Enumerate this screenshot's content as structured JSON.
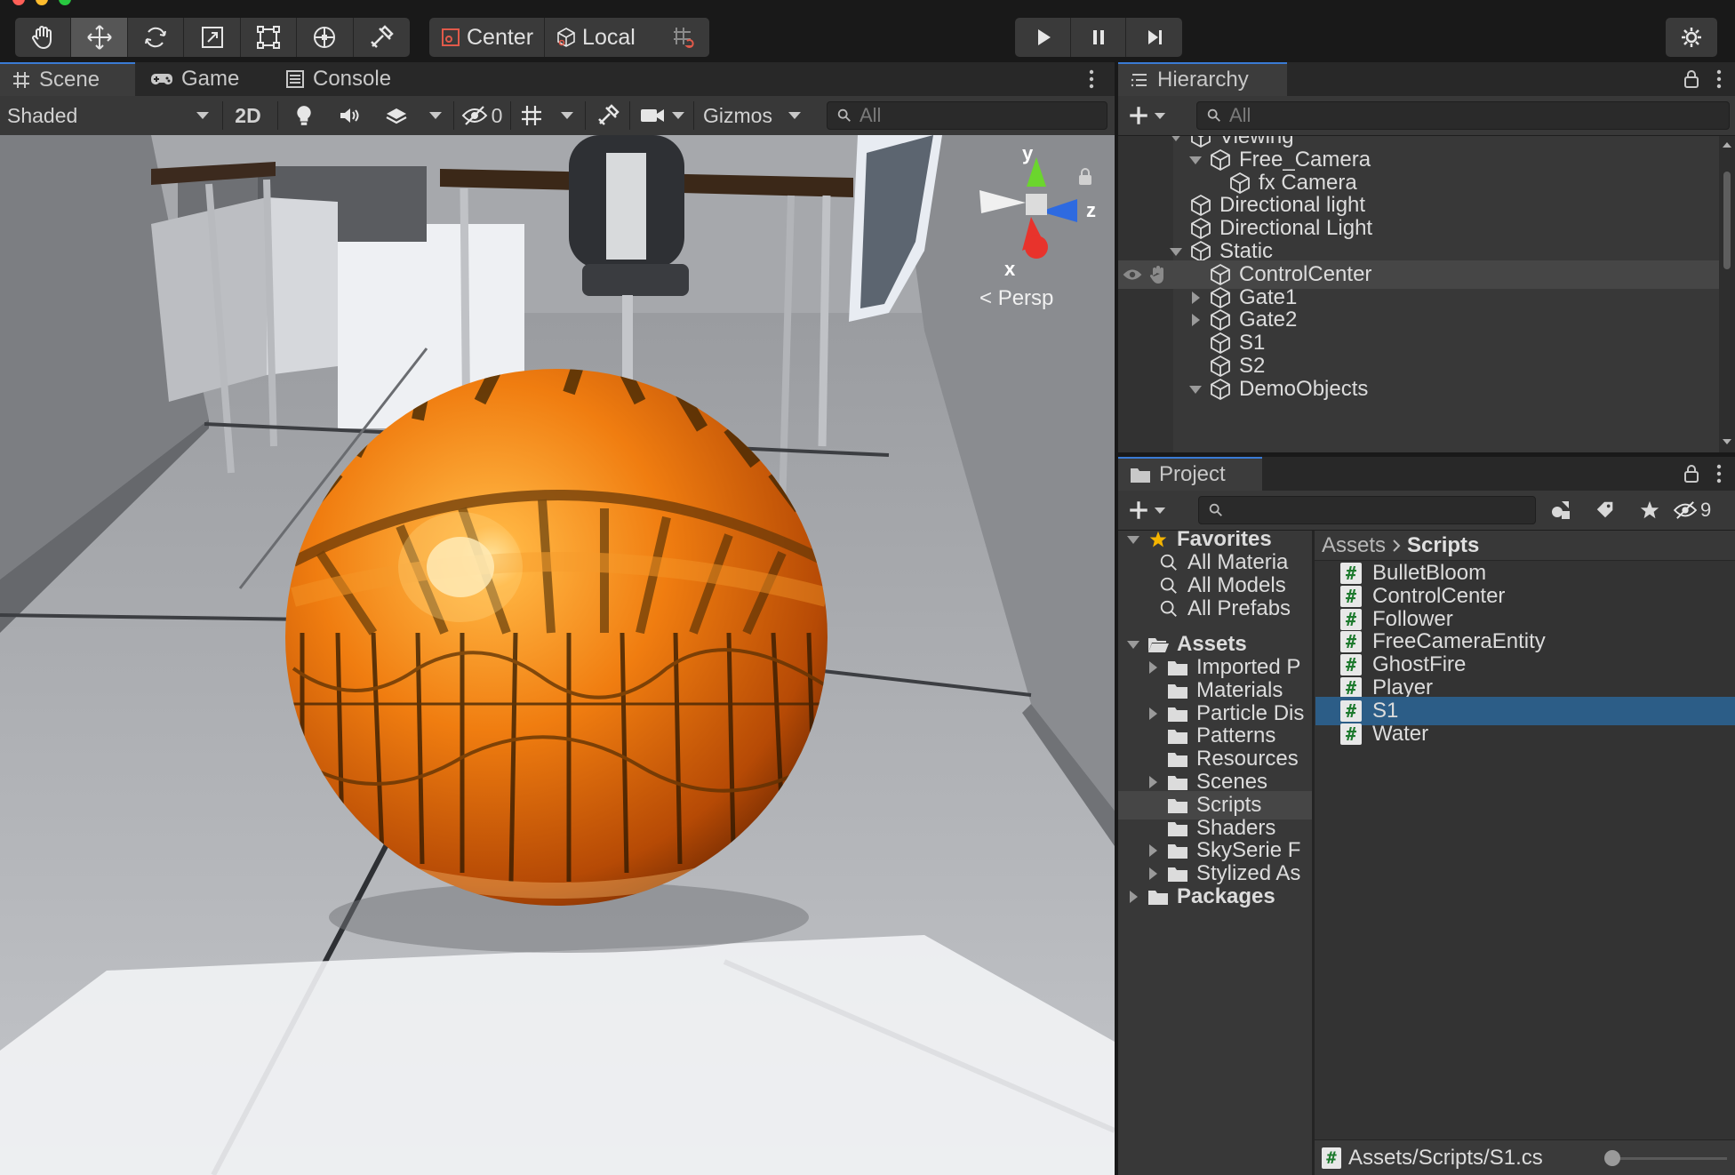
{
  "toolbar": {
    "pivot_label": "Center",
    "space_label": "Local"
  },
  "scene_tabs": [
    {
      "label": "Scene"
    },
    {
      "label": "Game"
    },
    {
      "label": "Console"
    }
  ],
  "scene_toolbar": {
    "draw_mode": "Shaded",
    "mode_2d": "2D",
    "hidden_count": "0",
    "gizmos": "Gizmos",
    "search_placeholder": "All"
  },
  "scene_view": {
    "axis_y": "y",
    "axis_x": "x",
    "axis_z": "z",
    "projection": "Persp"
  },
  "hierarchy": {
    "title": "Hierarchy",
    "search_placeholder": "All",
    "items": [
      {
        "label": "Viewing",
        "indent": 2,
        "fold": "open"
      },
      {
        "label": "Free_Camera",
        "indent": 3,
        "fold": "open"
      },
      {
        "label": "fx Camera",
        "indent": 4,
        "fold": "none"
      },
      {
        "label": "Directional light",
        "indent": 2,
        "fold": "none"
      },
      {
        "label": "Directional Light",
        "indent": 2,
        "fold": "none"
      },
      {
        "label": "Static",
        "indent": 2,
        "fold": "open"
      },
      {
        "label": "ControlCenter",
        "indent": 3,
        "fold": "none",
        "selected": true
      },
      {
        "label": "Gate1",
        "indent": 3,
        "fold": "closed"
      },
      {
        "label": "Gate2",
        "indent": 3,
        "fold": "closed"
      },
      {
        "label": "S1",
        "indent": 3,
        "fold": "none"
      },
      {
        "label": "S2",
        "indent": 3,
        "fold": "none"
      },
      {
        "label": "DemoObjects",
        "indent": 3,
        "fold": "open"
      }
    ]
  },
  "project": {
    "title": "Project",
    "hidden_count": "9",
    "favorites": {
      "label": "Favorites",
      "items": [
        "All Materia",
        "All Models",
        "All Prefabs"
      ]
    },
    "assets": {
      "label": "Assets",
      "folders": [
        {
          "label": "Imported P",
          "fold": "closed"
        },
        {
          "label": "Materials",
          "fold": "none"
        },
        {
          "label": "Particle Dis",
          "fold": "closed"
        },
        {
          "label": "Patterns",
          "fold": "none"
        },
        {
          "label": "Resources",
          "fold": "none"
        },
        {
          "label": "Scenes",
          "fold": "closed"
        },
        {
          "label": "Scripts",
          "fold": "none",
          "selected": true
        },
        {
          "label": "Shaders",
          "fold": "none"
        },
        {
          "label": "SkySerie F",
          "fold": "closed"
        },
        {
          "label": "Stylized As",
          "fold": "closed"
        }
      ]
    },
    "packages_label": "Packages",
    "breadcrumb": [
      "Assets",
      "Scripts"
    ],
    "scripts": [
      {
        "label": "BulletBloom"
      },
      {
        "label": "ControlCenter"
      },
      {
        "label": "Follower"
      },
      {
        "label": "FreeCameraEntity"
      },
      {
        "label": "GhostFire"
      },
      {
        "label": "Player"
      },
      {
        "label": "S1",
        "selected": true
      },
      {
        "label": "Water"
      }
    ],
    "status_path": "Assets/Scripts/S1.cs"
  },
  "colors": {
    "accent_blue": "#3a7bd5",
    "selection_blue": "#2c5d87",
    "panel_bg": "#383838",
    "toolbar_bg": "#191919"
  }
}
